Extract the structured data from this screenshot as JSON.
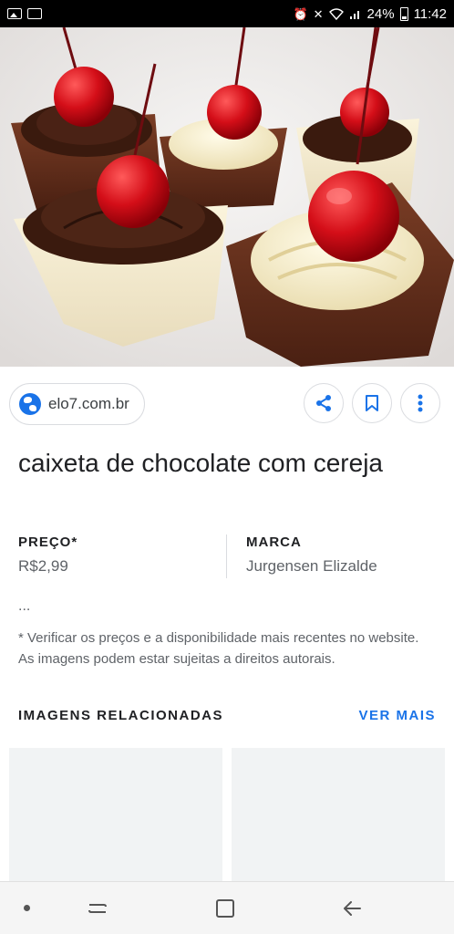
{
  "status_bar": {
    "battery": "24%",
    "time": "11:42",
    "icons": [
      "image-notification-icon",
      "cast-icon",
      "alarm-icon",
      "mute-icon",
      "wifi-icon",
      "signal-icon",
      "battery-icon"
    ]
  },
  "hero": {
    "subject": "chocolate-cups-with-cherries-image"
  },
  "source": {
    "domain": "elo7.com.br",
    "icon": "globe-icon"
  },
  "actions": {
    "share_icon": "share-icon",
    "bookmark_icon": "bookmark-icon",
    "more_icon": "more-vert-icon"
  },
  "product": {
    "title": "caixeta de chocolate com cereja",
    "price_label": "PREÇO*",
    "price_value": "R$2,99",
    "brand_label": "MARCA",
    "brand_value": "Jurgensen Elizalde",
    "ellipsis": "...",
    "disclaimer": "* Verificar os preços e a disponibilidade mais recentes no website. As imagens podem estar sujeitas a direitos autorais."
  },
  "related": {
    "title": "IMAGENS RELACIONADAS",
    "see_more": "VER MAIS"
  },
  "nav": {
    "icons": [
      "dot-icon",
      "recents-icon",
      "home-icon",
      "back-icon"
    ]
  },
  "colors": {
    "accent": "#1a73e8",
    "text_primary": "#202124",
    "text_secondary": "#5f6368",
    "border": "#dadce0"
  }
}
